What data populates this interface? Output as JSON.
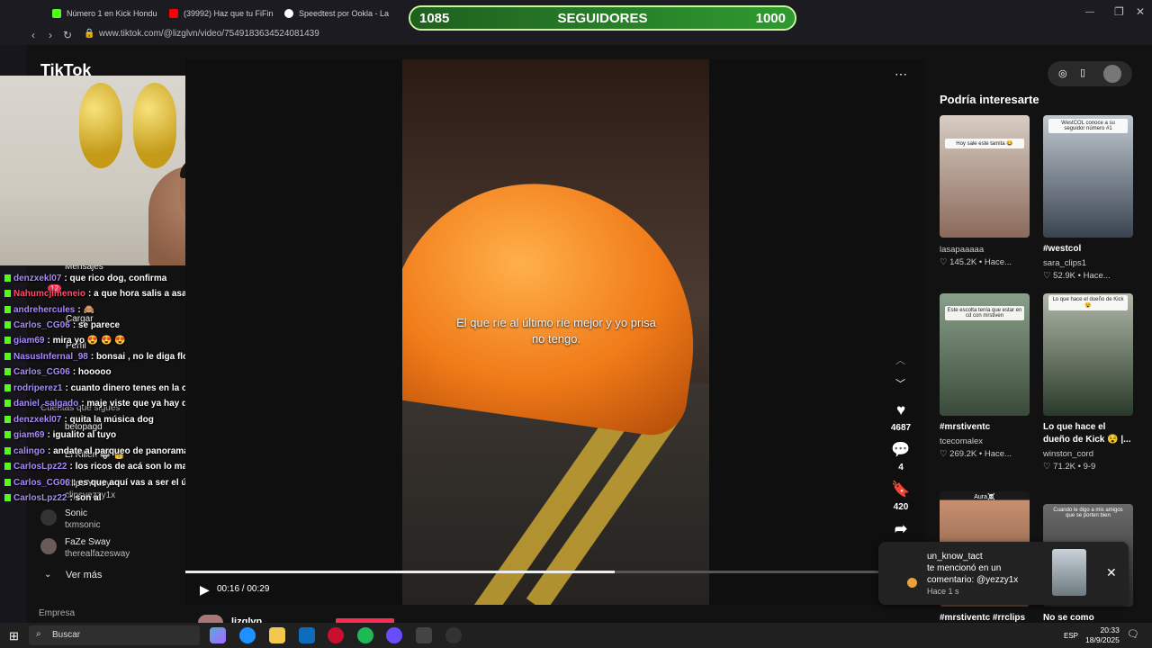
{
  "browser": {
    "tabs": [
      {
        "label": "Número 1 en Kick Hondu",
        "color": "#53fc18"
      },
      {
        "label": "(39992) Haz que tu FiFin",
        "color": "#ff0000"
      },
      {
        "label": "Speedtest por Ookla - La",
        "color": "#ffffff"
      }
    ],
    "url": "www.tiktok.com/@lizglvn/video/7549183634524081439"
  },
  "followers_bar": {
    "current": "1085",
    "label": "SEGUIDORES",
    "goal": "1000",
    "progress_fraction": 1.0
  },
  "sidebar": {
    "logo": "TikTok",
    "items": [
      {
        "label": "Mensajes",
        "icon": "message-icon"
      },
      {
        "label": "Cargar",
        "icon": "upload-icon"
      },
      {
        "label": "Perfil",
        "icon": "profile-icon"
      }
    ],
    "messages_badge": "12",
    "following_header": "Cuentas que sigues",
    "following": [
      {
        "name": "betopagd",
        "handle": ""
      },
      {
        "name": "El Killen 🐺 👑",
        "handle": ""
      },
      {
        "name": "Clips Yezzy",
        "handle": "clipsyezzy1x"
      },
      {
        "name": "Sonic",
        "handle": "txmsonic"
      },
      {
        "name": "FaZe Sway",
        "handle": "therealfazesway"
      }
    ],
    "see_more": "Ver más",
    "company": "Empresa"
  },
  "chat": [
    {
      "user": "denzxekl07",
      "color": "#a78bfa",
      "msg": "que rico dog, confirma"
    },
    {
      "user": "Nahumcjimeneio",
      "color": "#ff4d6d",
      "msg": "a que hora salis a asaltar"
    },
    {
      "user": "andrehercules",
      "color": "#a78bfa",
      "msg": "🙈"
    },
    {
      "user": "Carlos_CG06",
      "color": "#a78bfa",
      "msg": "se parece"
    },
    {
      "user": "giam69",
      "color": "#a78bfa",
      "msg": "mira yo 😍 😍 😍"
    },
    {
      "user": "NasusInfernal_98",
      "color": "#a78bfa",
      "msg": "bonsai , no le diga flor de barranco"
    },
    {
      "user": "Carlos_CG06",
      "color": "#a78bfa",
      "msg": "hooooo"
    },
    {
      "user": "rodriperez1",
      "color": "#a78bfa",
      "msg": "cuanto dinero tenes en la cuenta"
    },
    {
      "user": "daniel_salgado",
      "color": "#a78bfa",
      "msg": "maje viste que ya hay dos lambas aquí en honduras"
    },
    {
      "user": "denzxekl07",
      "color": "#a78bfa",
      "msg": "quita la música dog"
    },
    {
      "user": "giam69",
      "color": "#a78bfa",
      "msg": "igualito al tuyo"
    },
    {
      "user": "calingo",
      "color": "#a78bfa",
      "msg": "andate al parqueo de panorama para vivir la movie"
    },
    {
      "user": "CarlosLpz22",
      "color": "#a78bfa",
      "msg": "los ricos de acá son lo mas bajo en billete de allá"
    },
    {
      "user": "Carlos_CG06",
      "color": "#a78bfa",
      "msg": "es que aquí vas a ser el único y allá no sos nadie"
    },
    {
      "user": "CarlosLpz22",
      "color": "#a78bfa",
      "msg": "son al"
    }
  ],
  "video": {
    "caption": "El que ríe al último ríe mejor y yo prisa no tengo.",
    "time": "00:16 / 00:29",
    "progress_fraction": 0.62,
    "author": "lizglvn"
  },
  "actions": {
    "likes": "4687",
    "comments": "4",
    "saves": "420"
  },
  "recommend": {
    "title": "Podría interesarte",
    "cards": [
      {
        "title": "",
        "author": "lasapaaaaa",
        "stats": "145.2K • Hace...",
        "thumb_text": "Hoy sale este tamita 😂",
        "bg": "#8a6a5a"
      },
      {
        "title": "#westcol",
        "author": "sara_clips1",
        "stats": "52.9K • Hace...",
        "thumb_text": "WestCOL conoce a su seguidor número #1",
        "bg": "#8090a0"
      },
      {
        "title": "#mrstiventc",
        "author": "tcecomalex",
        "stats": "269.2K • Hace...",
        "thumb_text": "Este escolta tenía que estar en cd con mrstiven",
        "bg": "#5a7a6a"
      },
      {
        "title": "Lo que hace el dueño de Kick 😵 |...",
        "author": "winston_cord",
        "stats": "71.2K • 9-9",
        "thumb_text": "Lo que hace el dueño de Kick 😵",
        "bg": "#4a5a3a"
      },
      {
        "title": "#mrstiventc #rrclips",
        "author": "",
        "stats": "",
        "thumb_text": "Aura☠️",
        "bg": "#7a5a4a"
      },
      {
        "title": "No se como",
        "author": "",
        "stats": "",
        "thumb_text": "Cuando le digo a mis amigos que se porten bien",
        "bg": "#5a5a5a"
      }
    ]
  },
  "notification": {
    "user": "un_know_tact",
    "line1": "te mencionó en un",
    "line2": "comentario: @yezzy1x",
    "time": "Hace 1 s"
  },
  "taskbar": {
    "search": "Buscar",
    "lang": "ESP",
    "time": "20:33",
    "date": "18/9/2025"
  }
}
